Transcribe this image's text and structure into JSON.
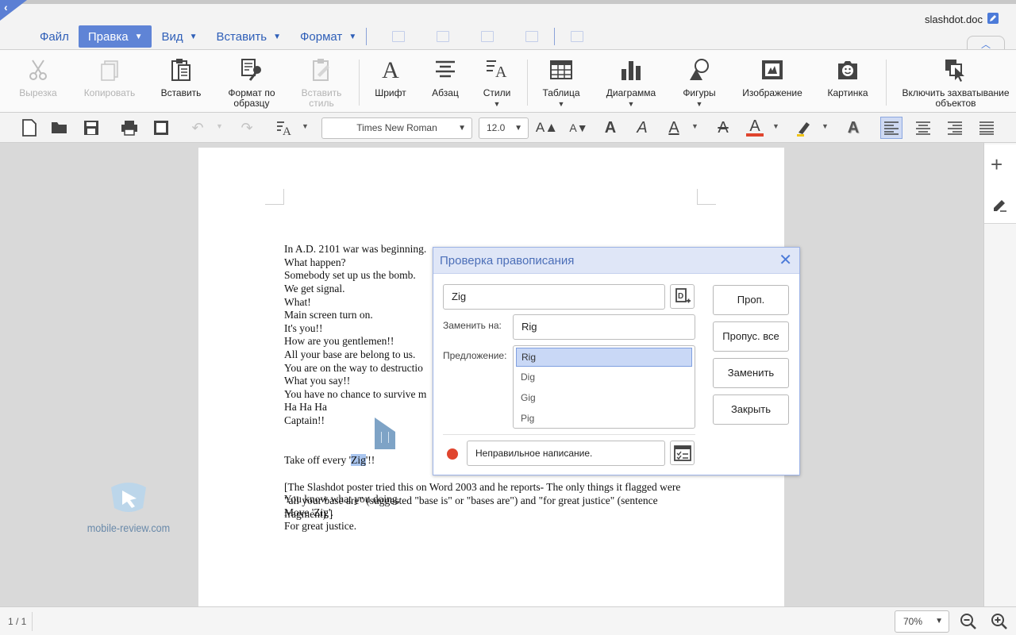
{
  "window": {
    "document_name": "slashdot.doc",
    "back_icon": "chevron-left-icon",
    "edit_icon": "pencil-square-icon",
    "collapse_icon": "chevron-up-icon"
  },
  "menu": {
    "items": [
      {
        "label": "Файл",
        "has_caret": false
      },
      {
        "label": "Правка",
        "has_caret": true,
        "active": true
      },
      {
        "label": "Вид",
        "has_caret": true
      },
      {
        "label": "Вставить",
        "has_caret": true
      },
      {
        "label": "Формат",
        "has_caret": true
      }
    ],
    "quick_icons": [
      "table-icon",
      "chart-icon",
      "image-icon",
      "shapes-icon",
      "picture-icon"
    ]
  },
  "ribbon": {
    "cut": "Вырезка",
    "copy": "Копировать",
    "paste": "Вставить",
    "format_painter": "Формат по образцу",
    "paste_style": "Вставить стиль",
    "font": "Шрифт",
    "paragraph": "Абзац",
    "styles": "Стили",
    "table": "Таблица",
    "chart": "Диаграмма",
    "shapes": "Фигуры",
    "image": "Изображение",
    "picture": "Картинка",
    "capture": "Включить захватывание объектов"
  },
  "format_bar": {
    "font_family": "Times New Roman",
    "font_size": "12.0",
    "increase_font_icon": "A▲",
    "decrease_font_icon": "A▼",
    "bold_label": "A",
    "italic_label": "A",
    "underline_label": "A",
    "strike_label": "A",
    "font_color_label": "A",
    "font_color": "#e0452e",
    "shadow_label": "A",
    "accent": "#5f84d6"
  },
  "document": {
    "lines_before": [
      "In A.D. 2101 war was beginning.",
      "What happen?",
      "Somebody set up us the bomb.",
      "We get signal.",
      "What!",
      "Main screen turn on.",
      "It's you!!",
      "How are you gentlemen!!",
      "All your base are belong to us.",
      "You are on the way to destructio",
      "What you say!!",
      "You have no chance to survive m",
      "Ha Ha Ha",
      "Captain!!"
    ],
    "highlight_line": {
      "prefix": "Take off every '",
      "word": "Zig",
      "suffix": "'!!"
    },
    "lines_after": [
      "You know what you doing.",
      "Move 'Zig'.",
      "For great justice."
    ],
    "note": "[The Slashdot poster tried this on Word 2003 and he reports- The only things it flagged were \"all your base are\" (suggested \"base is\" or \"bases are\") and \"for great justice\" (sentence fragment).]"
  },
  "watermark": {
    "label": "mobile-review.com"
  },
  "spell_dialog": {
    "title": "Проверка правописания",
    "word": "Zig",
    "replace_label": "Заменить на:",
    "replace_value": "Rig",
    "suggestions_label": "Предложение:",
    "suggestions": [
      "Rig",
      "Dig",
      "Gig",
      "Pig"
    ],
    "selected_suggestion": "Rig",
    "status": "Неправильное написание.",
    "status_color": "#e0452e",
    "buttons": {
      "skip": "Проп.",
      "skip_all": "Пропус. все",
      "replace": "Заменить",
      "close": "Закрыть"
    }
  },
  "status_bar": {
    "page_count": "1 / 1",
    "zoom": "70%"
  }
}
